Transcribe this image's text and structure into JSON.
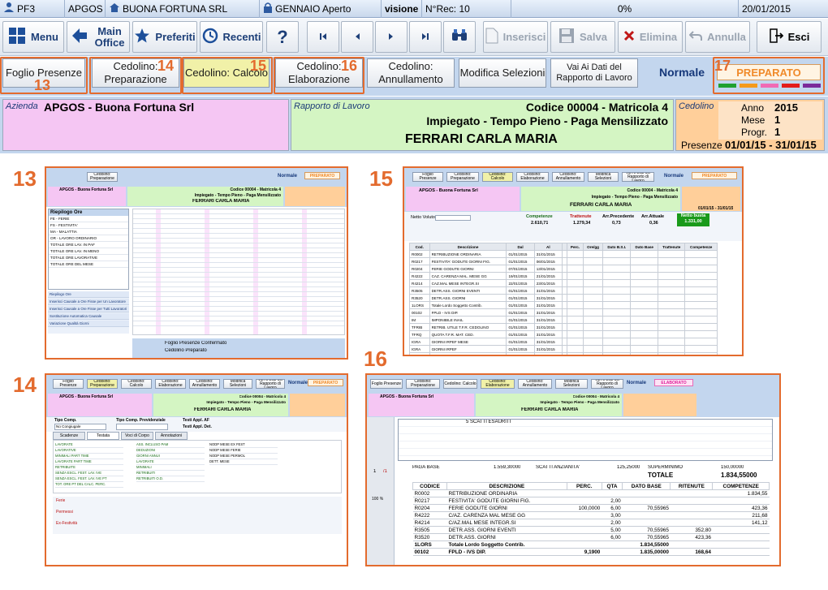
{
  "status_bar": {
    "app": "PF3",
    "company_code": "APGOS",
    "company_name": "BUONA FORTUNA SRL",
    "period": "GENNAIO Aperto",
    "mode": "visione",
    "record_count": "N°Rec: 10",
    "progress": "0%",
    "date": "20/01/2015"
  },
  "toolbar": {
    "menu": "Menu",
    "main_office": "Main Office",
    "preferiti": "Preferiti",
    "recenti": "Recenti",
    "help": "?",
    "inserisci": "Inserisci",
    "salva": "Salva",
    "elimina": "Elimina",
    "annulla": "Annulla",
    "esci": "Esci"
  },
  "tabs": {
    "foglio_presenze": "Foglio Presenze",
    "cedolino_preparazione": "Cedolino: Preparazione",
    "cedolino_calcolo": "Cedolino: Calcolo",
    "cedolino_elaborazione": "Cedolino: Elaborazione",
    "cedolino_annullamento": "Cedolino: Annullamento",
    "modifica_selezioni": "Modifica Selezioni",
    "vai_ai_dati": "Vai Ai Dati del Rapporto di Lavoro",
    "mode_label": "Normale",
    "status_badge": "PREPARATO"
  },
  "callouts": {
    "n13": "13",
    "n14": "14",
    "n15": "15",
    "n16": "16",
    "n17": "17"
  },
  "status_colors": [
    "#20a030",
    "#f59a1b",
    "#f06ab4",
    "#e31c1c",
    "#7b2a9a"
  ],
  "info": {
    "azienda_caption": "Azienda",
    "azienda_value": "APGOS - Buona Fortuna Srl",
    "rapporto_caption": "Rapporto di Lavoro",
    "rapporto_line1": "Codice 00004 - Matricola 4",
    "rapporto_line2": "Impiegato - Tempo Pieno - Paga Mensilizzato",
    "employee_name": "FERRARI CARLA MARIA",
    "cedolino_caption": "Cedolino",
    "anno_label": "Anno",
    "anno_value": "2015",
    "mese_label": "Mese",
    "mese_value": "1",
    "progr_label": "Progr.",
    "progr_value": "1",
    "presenze_label": "Presenze",
    "presenze_value": "01/01/15 - 31/01/15"
  },
  "thumb13": {
    "riepilogo_title": "Riepilogo Ore",
    "col_causali": "Causali",
    "col_quantita": "Quantità",
    "rows": [
      "FE - FERIE",
      "FS - FESTIVITA'",
      "MA - MALATTIA",
      "OR - LAVORO ORDINARIO",
      "TOTALE ORE LAV. IN PAF",
      "TOTALE ORE LAV. IN MENO",
      "TOTALE ORE LAVORATIVE",
      "TOTALE ORE DEL MESE"
    ],
    "footer": "Foglio Presenze Confermato",
    "footer2": "Cedolino Preparato",
    "menu_items": [
      "Riepilogo Ore",
      "Inserisci Causale a Ore Fisse per Un Lavoratore",
      "Inserisci Causale a Ore Fisse per Tutti Lavoratori",
      "Sostituzione Automatica Causale",
      "Variazione Qualità Giorni"
    ]
  },
  "thumb14": {
    "tipo_comp": "Tipo Comp.",
    "tipo_comp_prev": "Tipo Comp. Previdenziale",
    "non_congiuggato": "No Congiugale",
    "testi_af": "Testi Appl. AF",
    "testi_det": "Testi Appl. Det.",
    "tabs": [
      "Scadenze",
      "Testata",
      "Voci di Corpo",
      "Annotazioni"
    ],
    "left_rows": [
      "LAVORATE",
      "LAVORATIVE",
      "MINIMALI PART TIME",
      "LAVORATE PART TIME",
      "RETRIBUITE",
      "SENZA ESCL. FEST. LAV. IVE",
      "SENZA ESCL. FEST. LAV. IVE PT",
      "TOT. ORE PT DEL CALC. PERC."
    ],
    "mid_rows": [
      "ASS. INCLUSO PAM",
      "DEDUZIONI",
      "GIORNI ANNUI",
      "LAVORATE",
      "MINIMALI",
      "RETRIBUITI",
      "RETRIBUITI O.D."
    ],
    "right_rows": [
      "NODP MESE EX FEST",
      "NODP MESE FERIE",
      "NODP MESE PERMOL",
      "DETT. MESE"
    ],
    "ferie": "Ferie",
    "permessi": "Permessi",
    "ex_festivita": "Ex-Festività"
  },
  "thumb15": {
    "netto_voluto": "Netto Voluto",
    "competenze": "Competenze",
    "competenze_val": "2.610,71",
    "trattenute": "Trattenute",
    "trattenute_val": "1.279,34",
    "arr_prec": "Arr.Precedente",
    "arr_prec_val": "0,73",
    "arr_attuale": "Arr.Attuale",
    "arr_attuale_val": "0,36",
    "netto_busta": "Netto busta",
    "netto_busta_val": "1.331,00",
    "headers": [
      "Cod.",
      "Descrizione",
      "Dal",
      "Al",
      "",
      "Perc.",
      "Ore/gg",
      "Dato B.S.I.",
      "Dato Base",
      "Trattenute",
      "Competenze"
    ],
    "rows": [
      [
        "R0002",
        "RETRIBUZIONE ORDINARIA",
        "01/01/2015",
        "31/01/2015"
      ],
      [
        "R0217",
        "FESTIVITA' GODUTE GIORNI FIG.",
        "01/01/2015",
        "06/01/2015"
      ],
      [
        "R0204",
        "FERIE GODUTE GIORNI",
        "07/01/2015",
        "13/01/2015"
      ],
      [
        "R4222",
        "CAZ. CARENZA MAL. MESE GG",
        "19/01/2015",
        "21/01/2015"
      ],
      [
        "R4214",
        "CAZ.MAL MESE INTEGR.SI",
        "22/01/2015",
        "23/01/2015"
      ],
      [
        "R3505",
        "DETR.ASS. GIORNI EVENTI",
        "01/01/2015",
        "31/01/2015"
      ],
      [
        "R3520",
        "DETR.ASS. GIORNI",
        "01/01/2015",
        "31/01/2015"
      ],
      [
        "1LORS",
        "Totale Lordo Soggetto Contrib.",
        "01/01/2015",
        "31/01/2015"
      ],
      [
        "00102",
        "FPLD - IVS DIP.",
        "01/01/2015",
        "31/01/2015"
      ],
      [
        "IM",
        "IMPONIBILE INAIL",
        "01/01/2015",
        "31/01/2015"
      ],
      [
        "TFRIB",
        "RETRIB. UTILE T.F.R. CEDOLINO",
        "01/01/2015",
        "31/01/2015"
      ],
      [
        "TFRQ",
        "QUOTA T.F.R. MAT. CED.",
        "01/01/2015",
        "31/01/2015"
      ],
      [
        "IGRA",
        "GIORNI IRPEF MESE",
        "01/01/2015",
        "31/01/2015"
      ],
      [
        "IGRA",
        "GIORNI IRPEF",
        "01/01/2015",
        "31/01/2015"
      ],
      [
        "IRPR",
        "Reddito Presunto",
        "01/01/2015",
        "31/01/2015"
      ],
      [
        "IRIDP",
        "Tassazione Ord. Reddito MESE",
        "01/01/2015",
        "31/01/2015"
      ],
      [
        "EXR2",
        "COEF.DETR.PERS.ART.13C1 let.b",
        "01/01/2015",
        "31/01/2015"
      ]
    ]
  },
  "thumb16": {
    "badge": "ELABORATO",
    "scatti": "5 SCATTI ESAURITI",
    "paga_base": "PAGA BASE",
    "paga_base_val": "1.559,30000",
    "scatti_anz": "SCATTI ANZIANITA'",
    "scatti_anz_val": "125,25000",
    "superminimo": "SUPERMINIMO",
    "superminimo_val": "150,00000",
    "totale": "TOTALE",
    "totale_val": "1.834,55000",
    "headers": [
      "CODICE",
      "DESCRIZIONE",
      "PERC.",
      "QTA",
      "DATO BASE",
      "RITENUTE",
      "COMPETENZE"
    ],
    "rows": [
      [
        "R0002",
        "RETRIBUZIONE ORDINARIA",
        "",
        "",
        "",
        "",
        "1.834,55"
      ],
      [
        "R0217",
        "FESTIVITA' GODUTE GIORNI FIG.",
        "",
        "2,00",
        "",
        "",
        ""
      ],
      [
        "R0204",
        "FERIE GODUTE GIORNI",
        "100,0000",
        "6,00",
        "70,55965",
        "",
        "423,36"
      ],
      [
        "R4222",
        "C/AZ. CARENZA MAL MESE GG",
        "",
        "3,00",
        "",
        "",
        "211,68"
      ],
      [
        "R4214",
        "C/AZ.MAL MESE INTEGR.SI",
        "",
        "2,00",
        "",
        "",
        "141,12"
      ],
      [
        "R3505",
        "DETR.ASS. GIORNI EVENTI",
        "",
        "5,00",
        "70,55965",
        "352,80",
        ""
      ],
      [
        "R3520",
        "DETR.ASS. GIORNI",
        "",
        "6,00",
        "70,55965",
        "423,36",
        ""
      ],
      [
        "1LORS",
        "Totale Lordo Soggetto Contrib.",
        "",
        "",
        "1.834,55000",
        "",
        ""
      ],
      [
        "00102",
        "FPLD - IVS DIP.",
        "9,1900",
        "",
        "1.835,00000",
        "168,64",
        ""
      ]
    ],
    "side_page": "1",
    "side_of": "/1",
    "side_zoom": "100 %"
  }
}
